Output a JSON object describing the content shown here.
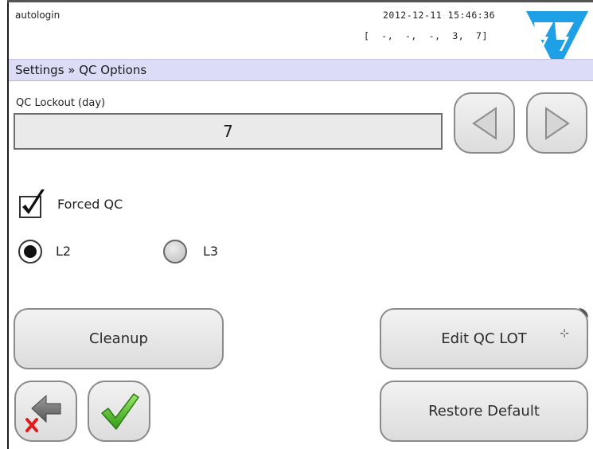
{
  "header": {
    "user": "autologin",
    "datetime": "2012-12-11 15:46:36",
    "indicators": "[  -,  -,  -,  3,  7]"
  },
  "breadcrumb": "Settings » QC Options",
  "lockout": {
    "label": "QC Lockout (day)",
    "value": "7"
  },
  "forced_qc": {
    "label": "Forced QC",
    "checked": true
  },
  "level_options": {
    "selected": "L2",
    "options": [
      "L2",
      "L3"
    ]
  },
  "buttons": {
    "cleanup": "Cleanup",
    "edit_qc_lot": "Edit QC LOT",
    "restore_default": "Restore Default"
  },
  "icons": {
    "prev": "left-triangle-icon",
    "next": "right-triangle-icon",
    "back": "back-arrow-cancel-icon",
    "confirm": "green-checkmark-icon",
    "logo": "77-logo-icon"
  },
  "colors": {
    "breadcrumb_bg": "#dcdcf6",
    "logo_blue": "#1ea0e6",
    "check_green": "#4cc02a",
    "cancel_red": "#e11a1a"
  }
}
